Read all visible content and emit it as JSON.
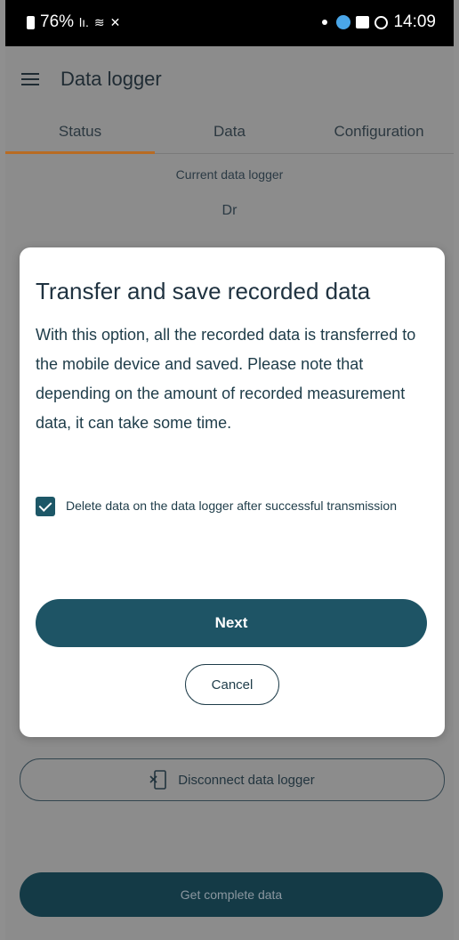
{
  "status_bar": {
    "battery": "76%",
    "signal_text": "lı.",
    "time": "14:09"
  },
  "app_bar": {
    "title": "Data logger",
    "menu_icon": "menu-icon"
  },
  "tabs": [
    {
      "label": "Status",
      "active": true
    },
    {
      "label": "Data",
      "active": false
    },
    {
      "label": "Configuration",
      "active": false
    }
  ],
  "current_logger": {
    "label": "Current data logger",
    "value": "Dr"
  },
  "dialog": {
    "title": "Transfer and save recorded data",
    "body": "With this option, all the recorded data is transferred to the mobile device and saved. Please note that depending on the amount of recorded measurement data, it can take some time.",
    "checkbox": {
      "checked": true,
      "label": "Delete data on the data logger after successful transmission"
    },
    "next_label": "Next",
    "cancel_label": "Cancel"
  },
  "disconnect_button": {
    "label": "Disconnect data logger",
    "icon": "disconnect-icon"
  },
  "get_data_button": {
    "label": "Get complete data"
  },
  "colors": {
    "primary": "#1e5465",
    "tab_indicator": "#b86b23",
    "overlay": "#8c8c8c"
  }
}
